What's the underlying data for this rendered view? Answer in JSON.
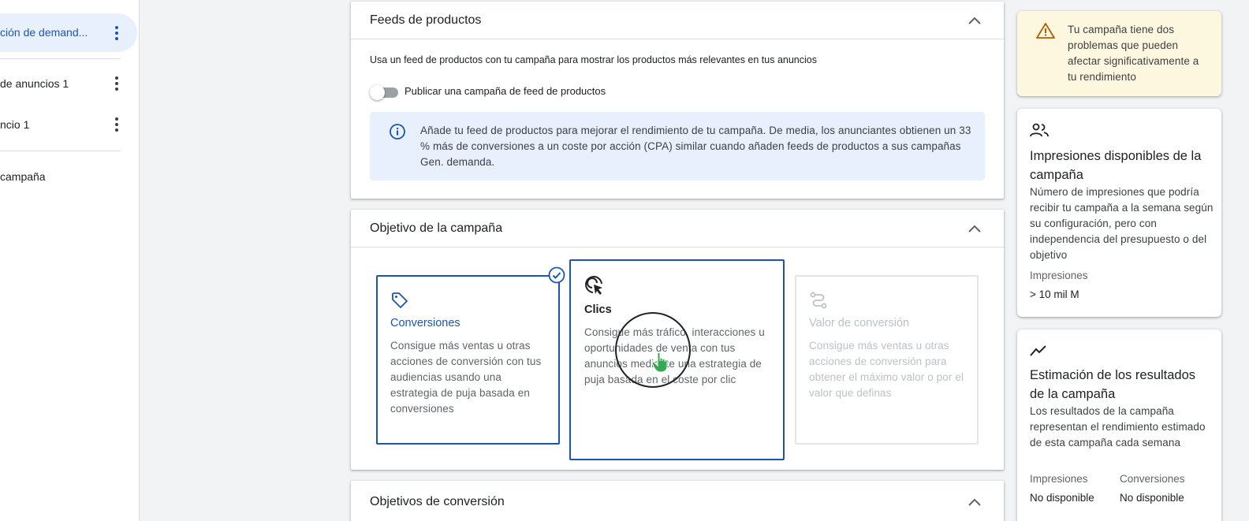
{
  "sidebar": {
    "items": [
      {
        "label": "ción de demand..."
      },
      {
        "label": "de anuncios 1"
      },
      {
        "label": "ncio 1"
      },
      {
        "label": "campaña"
      }
    ]
  },
  "feeds": {
    "title": "Feeds de productos",
    "description": "Usa un feed de productos con tu campaña para mostrar los productos más relevantes en tus anuncios",
    "toggle_label": "Publicar una campaña de feed de productos",
    "toggle_on": false,
    "info": "Añade tu feed de productos para mejorar el rendimiento de tu campaña. De media, los anunciantes obtienen un 33 % más de conversiones a un coste por acción (CPA) similar cuando añaden feeds de productos a sus campañas Gen. demanda."
  },
  "objective": {
    "title": "Objetivo de la campaña",
    "options": [
      {
        "title": "Conversiones",
        "description": "Consigue más ventas u otras acciones de conversión con tus audiencias usando una estrategia de puja basada en conversiones",
        "icon": "tag-icon",
        "state": "selected"
      },
      {
        "title": "Clics",
        "description": "Consigue más tráfico, interacciones u oportunidades de venta con tus anuncios mediante una estrategia de puja basada en el coste por clic",
        "icon": "cursor-click-icon",
        "state": "hovered"
      },
      {
        "title": "Valor de conversión",
        "description": "Consigue más ventas u otras acciones de conversión para obtener el máximo valor o por el valor que definas",
        "icon": "route-icon",
        "state": "disabled"
      }
    ]
  },
  "conversion_goals": {
    "title": "Objetivos de conversión"
  },
  "right_panel": {
    "warning": "Tu campaña tiene dos problemas que pueden afectar significativamente a tu rendimiento",
    "impressions_card": {
      "title": "Impresiones disponibles de la campaña",
      "description": "Número de impresiones que podría recibir tu campaña a la semana según su configuración, pero con independencia del presupuesto o del objetivo",
      "label": "Impresiones",
      "value": "> 10 mil M"
    },
    "results_card": {
      "title": "Estimación de los resultados de la campaña",
      "description": "Los resultados de la campaña representan el rendimiento estimado de esta campaña cada semana",
      "impressions_label": "Impresiones",
      "impressions_value": "No disponible",
      "conversions_label": "Conversiones",
      "conversions_value": "No disponible"
    }
  },
  "colors": {
    "accent": "#1a56b0",
    "info_bg": "#e8f0fe",
    "warning_bg": "#fef7e0",
    "warning_icon": "#b06000",
    "cursor": "#34a853"
  }
}
